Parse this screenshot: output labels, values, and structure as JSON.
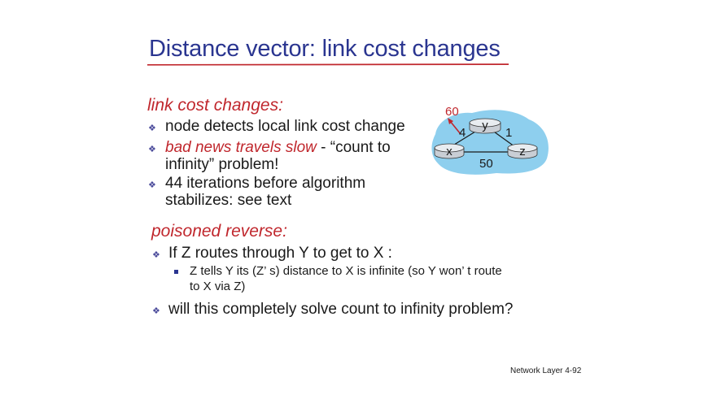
{
  "slide": {
    "title": "Distance vector: link cost changes",
    "section1": {
      "heading": "link cost changes:",
      "bullets": [
        {
          "text": "node detects local link cost change"
        },
        {
          "red": "bad news travels slow",
          "rest": " - “count to",
          "cont": "infinity” problem!"
        },
        {
          "text": "44 iterations before algorithm",
          "cont": "stabilizes: see text"
        }
      ]
    },
    "section2": {
      "heading": "poisoned reverse:",
      "bullet1": "If Z routes through Y to get to X :",
      "sub1": "Z tells Y its (Z’ s) distance to X is infinite (so Y won’ t route",
      "sub1_cont": "to X via Z)",
      "bullet2": "will this completely solve count to infinity problem?"
    },
    "footer": "Network Layer  4-92"
  },
  "diagram": {
    "nodes": {
      "x": "x",
      "y": "y",
      "z": "z"
    },
    "costs": {
      "new_xy": "60",
      "xy": "4",
      "yz": "1",
      "xz": "50"
    },
    "colors": {
      "cloud": "#8ecfee",
      "router": "#d8dde3",
      "arrow": "#c0272d"
    }
  }
}
